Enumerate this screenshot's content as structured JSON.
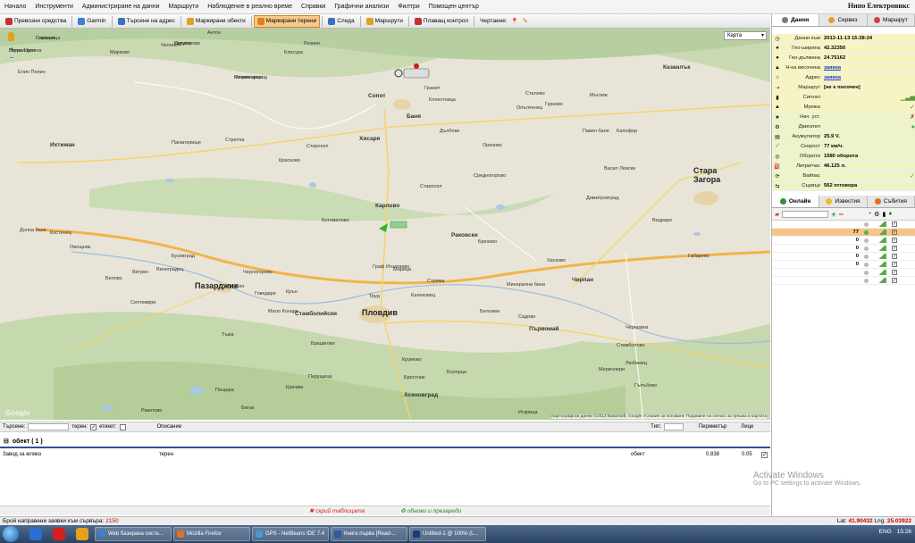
{
  "menu": [
    "Начало",
    "Инструменти",
    "Администриране на данни",
    "Маршрути",
    "Наблюдение в реално време",
    "Справки",
    "Графични анализи",
    "Филтри",
    "Помощен център"
  ],
  "brand": "Нипо Електроникс",
  "toolbar": {
    "buttons": [
      "Превозни средства",
      "Garmin",
      "Търсене на адрес",
      "Маркирани обекти",
      "Маркирани терени",
      "Следа",
      "Маршрути",
      "Плаващ контрол"
    ],
    "drawing_label": "Чертаене:",
    "active_index": 4
  },
  "map": {
    "type_select": "Карта",
    "attribution": "Картографски данни ©2013 Basarsoft, Google   Условия за ползване   Подаване на сигнал за грешка в картата",
    "google_logo": "Google",
    "towns_big": [
      "Пловдив",
      "Стара Загора",
      "Пазарджик"
    ],
    "towns_mid": [
      "Карлово",
      "Асеновград",
      "Чирпан",
      "Първомай",
      "Казанлък",
      "Раковски",
      "Ихтиман",
      "Стамболийски",
      "Хисаря",
      "Сопот",
      "Баня"
    ],
    "towns_small": [
      "Сарацко",
      "Горна Малина",
      "Пирдоп",
      "Копривщица",
      "Клисура",
      "Антон",
      "Челопеч",
      "Розино",
      "Стрелча",
      "Красново",
      "Старосел",
      "Мирково",
      "Панагюрище",
      "Елин Пелин",
      "Костенец",
      "Долна баня",
      "Белово",
      "Септември",
      "Ветрен",
      "Виноградец",
      "Черногорово",
      "Ивайло",
      "Мало Конаре",
      "Говедаре",
      "Труд",
      "Марица",
      "Брезово",
      "Стряма",
      "Граф Игнатиево",
      "Калековец",
      "Белозем",
      "Брестник",
      "Кричим",
      "Перущица",
      "Брацигово",
      "Пещера",
      "Батак",
      "Ракитово",
      "Крумово",
      "Болярци",
      "Садово",
      "Стамболово",
      "Гълъбово",
      "Чернозем",
      "Искрица",
      "Братя Даскалови",
      "Меричлери",
      "Любимец",
      "Минерални бани",
      "Хасково",
      "Димитровград",
      "Сталево",
      "Клокотница",
      "Гранит",
      "Дълбоки",
      "Опълченец",
      "Гурково",
      "Мъглиж",
      "Павел баня",
      "Калофер",
      "Васил Левски",
      "Ведраре",
      "Габарево",
      "Тъжа",
      "Крън",
      "Бузовград",
      "Овощник",
      "Средногорово",
      "Старосел",
      "Богомилово",
      "Оризово",
      "Главиница",
      "Ветрен дол",
      "Калугерово",
      "Момин проход"
    ]
  },
  "filterbar": {
    "search_label": "Търсене:",
    "terrain_label": "терен:",
    "label_label": "етикет:",
    "description_header": "Описание",
    "type_label": "Тип:",
    "perimeter_header": "Периметър",
    "area_header": "Лице"
  },
  "group": {
    "title": "обект ( 1 )"
  },
  "row": {
    "name": "Завод за мляко",
    "description": "терен",
    "type": "обект",
    "perimeter": "0.838",
    "area": "0.05"
  },
  "table_footer": {
    "hide": "скрий таблицата",
    "refresh": "обнови и презареди"
  },
  "status": {
    "label": "Брой направени заявки към сървъра:",
    "count": "2150",
    "lat_label": "Lat:",
    "lat": "41.90432",
    "lng_label": "Lng:",
    "lng": "25.03922"
  },
  "right_tabs": [
    "Данни",
    "Сервиз",
    "Маршрут"
  ],
  "info": [
    {
      "label": "Данни към",
      "value": "2013-11-13 15:28:24",
      "bg": "yellow"
    },
    {
      "label": "Гео-ширина",
      "value": "42.32350",
      "bg": "yellow"
    },
    {
      "label": "Гео-дължина",
      "value": "24.75162",
      "bg": "yellow"
    },
    {
      "label": "Н-ка височина",
      "value": "заявка",
      "bg": "yellow",
      "link": true
    },
    {
      "label": "Адрес",
      "value": "заявка",
      "bg": "yellow",
      "link": true
    },
    {
      "label": "Маршрут",
      "value": "[не е посочен]",
      "bg": "yellow"
    },
    {
      "label": "Сигнал",
      "value": "",
      "bg": "yellow"
    },
    {
      "label": "Мрежа",
      "value": "",
      "bg": "yellow"
    },
    {
      "label": "Нач. уст.",
      "value": "",
      "bg": "green"
    },
    {
      "label": "Двигател",
      "value": "",
      "bg": "green"
    },
    {
      "label": "Акумулатор",
      "value": "25.9 V.",
      "bg": "green"
    },
    {
      "label": "Скорост",
      "value": "77 км/ч.",
      "bg": "green"
    },
    {
      "label": "Обороти",
      "value": "1580 оборота",
      "bg": "green"
    },
    {
      "label": "Литри/час",
      "value": "46.125 л.",
      "bg": "green"
    },
    {
      "label": "Вайпас",
      "value": "",
      "bg": "green"
    },
    {
      "label": "Сървър",
      "value": "562 отговора",
      "bg": "green"
    }
  ],
  "online_tabs": [
    "Онлайн",
    "Известия",
    "Събития"
  ],
  "vehicles": [
    {
      "name": "",
      "num": "",
      "on": false,
      "selected": false
    },
    {
      "name": "",
      "num": "77",
      "on": true,
      "selected": true
    },
    {
      "name": "",
      "num": "0",
      "on": false,
      "selected": false
    },
    {
      "name": "",
      "num": "0",
      "on": false,
      "selected": false
    },
    {
      "name": "",
      "num": "0",
      "on": false,
      "selected": false
    },
    {
      "name": "",
      "num": "0",
      "on": false,
      "selected": false
    },
    {
      "name": "",
      "num": "",
      "on": false,
      "selected": false
    },
    {
      "name": "",
      "num": "",
      "on": false,
      "selected": false
    }
  ],
  "watermark": {
    "title": "Activate Windows",
    "subtitle": "Go to PC settings to activate Windows."
  },
  "taskbar": {
    "tasks": [
      "Web базирана систе...",
      "Mozilla Firefox",
      "GPS - NetBeans IDE 7.4",
      "Книга първа [Read-...",
      "Untitled-1 @ 100% (L..."
    ],
    "lang": "ENG",
    "time": "15:26"
  },
  "colors": {
    "accent": "#f7c98b",
    "road": "#f2b34a",
    "water": "#a9c8e8",
    "green": "#b9d69a"
  }
}
